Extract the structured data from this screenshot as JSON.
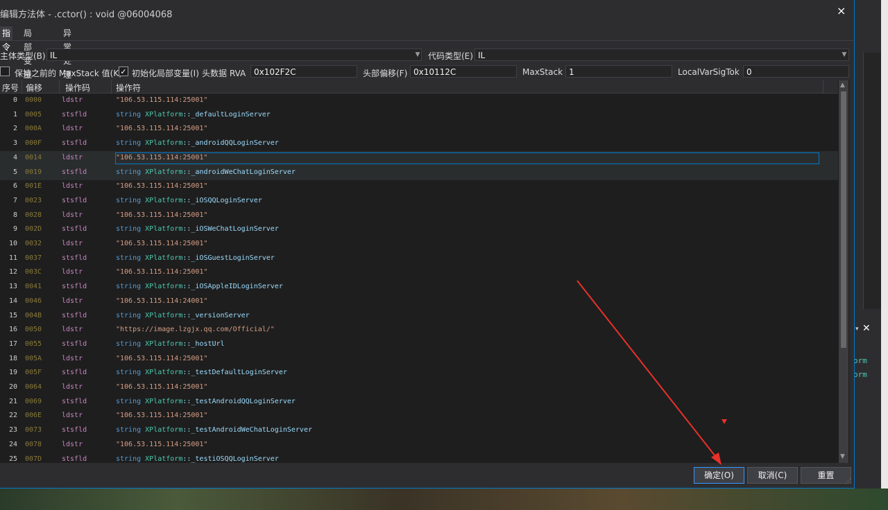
{
  "dialog": {
    "title": "编辑方法体 - .cctor() : void @06004068",
    "close_label": "×",
    "tabs": [
      "指令",
      "局部变量",
      "异常处理程序"
    ]
  },
  "props": {
    "body_type_label": "主体类型(B)",
    "body_type_value": "IL",
    "code_type_label": "代码类型(E)",
    "code_type_value": "IL",
    "keep_maxstack_label": "保持之前的 MaxStack 值(K)",
    "init_locals_label": "初始化局部变量(I)",
    "header_rva_label": "头数据 RVA",
    "header_rva_value": "0x102F2C",
    "header_offset_label": "头部偏移(F)",
    "header_offset_value": "0x10112C",
    "maxstack_label": "MaxStack",
    "maxstack_value": "1",
    "localvar_label": "LocalVarSigTok",
    "localvar_value": "0",
    "keep_maxstack_checked": false,
    "init_locals_checked": true
  },
  "grid": {
    "columns": [
      "序号",
      "偏移",
      "操作码",
      "操作符"
    ],
    "selected_index": 4,
    "rows": [
      {
        "idx": "0",
        "off": "0000",
        "op": "ldstr",
        "str": "\"106.53.115.114:25001\""
      },
      {
        "idx": "1",
        "off": "0005",
        "op": "stsfld",
        "kw": "string",
        "type": "XPlatform",
        "mem": "::_defaultLoginServer"
      },
      {
        "idx": "2",
        "off": "000A",
        "op": "ldstr",
        "str": "\"106.53.115.114:25001\""
      },
      {
        "idx": "3",
        "off": "000F",
        "op": "stsfld",
        "kw": "string",
        "type": "XPlatform",
        "mem": "::_androidQQLoginServer"
      },
      {
        "idx": "4",
        "off": "0014",
        "op": "ldstr",
        "str": "\"106.53.115.114:25001\""
      },
      {
        "idx": "5",
        "off": "0019",
        "op": "stsfld",
        "kw": "string",
        "type": "XPlatform",
        "mem": "::_androidWeChatLoginServer"
      },
      {
        "idx": "6",
        "off": "001E",
        "op": "ldstr",
        "str": "\"106.53.115.114:25001\""
      },
      {
        "idx": "7",
        "off": "0023",
        "op": "stsfld",
        "kw": "string",
        "type": "XPlatform",
        "mem": "::_iOSQQLoginServer"
      },
      {
        "idx": "8",
        "off": "0028",
        "op": "ldstr",
        "str": "\"106.53.115.114:25001\""
      },
      {
        "idx": "9",
        "off": "002D",
        "op": "stsfld",
        "kw": "string",
        "type": "XPlatform",
        "mem": "::_iOSWeChatLoginServer"
      },
      {
        "idx": "10",
        "off": "0032",
        "op": "ldstr",
        "str": "\"106.53.115.114:25001\""
      },
      {
        "idx": "11",
        "off": "0037",
        "op": "stsfld",
        "kw": "string",
        "type": "XPlatform",
        "mem": "::_iOSGuestLoginServer"
      },
      {
        "idx": "12",
        "off": "003C",
        "op": "ldstr",
        "str": "\"106.53.115.114:25001\""
      },
      {
        "idx": "13",
        "off": "0041",
        "op": "stsfld",
        "kw": "string",
        "type": "XPlatform",
        "mem": "::_iOSAppleIDLoginServer"
      },
      {
        "idx": "14",
        "off": "0046",
        "op": "ldstr",
        "str": "\"106.53.115.114:24001\""
      },
      {
        "idx": "15",
        "off": "004B",
        "op": "stsfld",
        "kw": "string",
        "type": "XPlatform",
        "mem": "::_versionServer"
      },
      {
        "idx": "16",
        "off": "0050",
        "op": "ldstr",
        "str": "\"https://image.lzgjx.qq.com/Official/\""
      },
      {
        "idx": "17",
        "off": "0055",
        "op": "stsfld",
        "kw": "string",
        "type": "XPlatform",
        "mem": "::_hostUrl"
      },
      {
        "idx": "18",
        "off": "005A",
        "op": "ldstr",
        "str": "\"106.53.115.114:25001\""
      },
      {
        "idx": "19",
        "off": "005F",
        "op": "stsfld",
        "kw": "string",
        "type": "XPlatform",
        "mem": "::_testDefaultLoginServer"
      },
      {
        "idx": "20",
        "off": "0064",
        "op": "ldstr",
        "str": "\"106.53.115.114:25001\""
      },
      {
        "idx": "21",
        "off": "0069",
        "op": "stsfld",
        "kw": "string",
        "type": "XPlatform",
        "mem": "::_testAndroidQQLoginServer"
      },
      {
        "idx": "22",
        "off": "006E",
        "op": "ldstr",
        "str": "\"106.53.115.114:25001\""
      },
      {
        "idx": "23",
        "off": "0073",
        "op": "stsfld",
        "kw": "string",
        "type": "XPlatform",
        "mem": "::_testAndroidWeChatLoginServer"
      },
      {
        "idx": "24",
        "off": "0078",
        "op": "ldstr",
        "str": "\"106.53.115.114:25001\""
      },
      {
        "idx": "25",
        "off": "007D",
        "op": "stsfld",
        "kw": "string",
        "type": "XPlatform",
        "mem": "::_testiOSQQLoginServer"
      }
    ]
  },
  "buttons": {
    "ok": "确定(O)",
    "cancel": "取消(C)",
    "reset": "重置"
  },
  "background": {
    "text1": "orm",
    "text2": "orm"
  },
  "colors": {
    "accent": "#007acc",
    "annotation_arrow": "#e8312a"
  }
}
